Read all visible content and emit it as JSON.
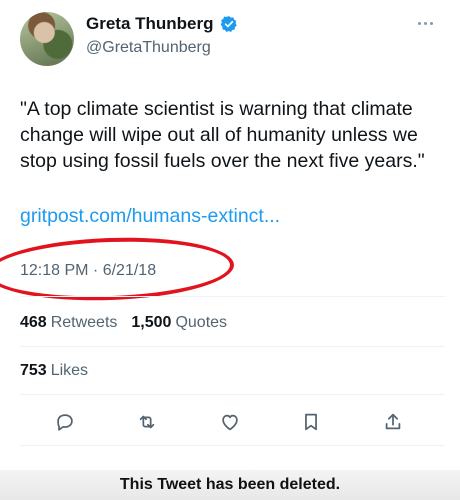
{
  "user": {
    "display_name": "Greta Thunberg",
    "handle": "@GretaThunberg",
    "verified": true
  },
  "tweet": {
    "text": "\"A top climate scientist is warning that climate change will wipe out all of humanity unless we stop using fossil fuels over the next five years.\"",
    "link": "gritpost.com/humans-extinct...",
    "timestamp": "12:18 PM · 6/21/18"
  },
  "stats": {
    "retweets_count": "468",
    "retweets_label": "Retweets",
    "quotes_count": "1,500",
    "quotes_label": "Quotes",
    "likes_count": "753",
    "likes_label": "Likes"
  },
  "actions": [
    "reply-icon",
    "retweet-icon",
    "like-icon",
    "bookmark-icon",
    "share-icon"
  ],
  "annotation": {
    "color": "#e1141e",
    "target": "timestamp"
  },
  "caption": "This Tweet has been deleted.",
  "colors": {
    "link": "#1d9bf0",
    "secondary_text": "#536471",
    "verified": "#1d9bf0"
  }
}
